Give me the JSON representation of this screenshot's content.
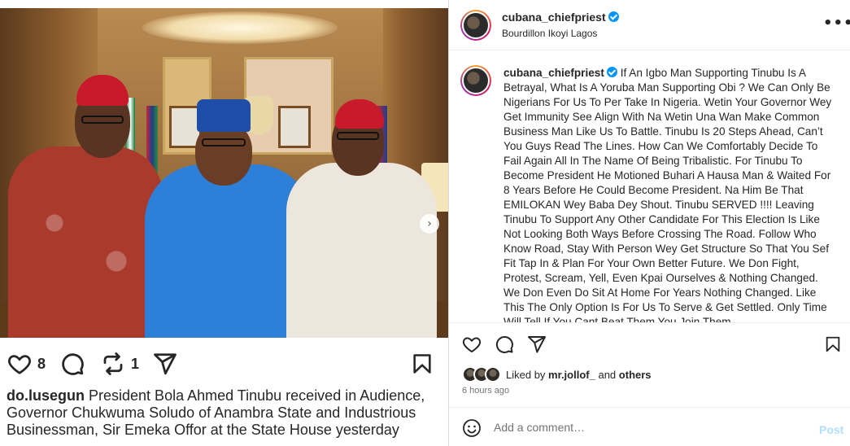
{
  "left_post": {
    "likes_count": "8",
    "reposts_count": "1",
    "caption_user": "do.lusegun",
    "caption_text": "President Bola Ahmed Tinubu received in Audience, Governor Chukwuma Soludo of Anambra State and Industrious Businessman, Sir Emeka Offor at the State House yesterday",
    "icons": [
      "heart-icon",
      "comment-icon",
      "repost-icon",
      "share-icon",
      "bookmark-icon",
      "next-arrow-icon"
    ]
  },
  "header": {
    "username": "cubana_chiefpriest",
    "location": "Bourdillon Ikoyi Lagos",
    "more_glyph": "•••"
  },
  "caption": {
    "username": "cubana_chiefpriest",
    "text": "If An Igbo Man Supporting Tinubu Is A Betrayal, What Is A Yoruba Man Supporting Obi ? We Can Only Be Nigerians For Us To Per Take In Nigeria. Wetin Your Governor Wey Get Immunity See Align With Na Wetin Una Wan Make Common Business Man Like Us To Battle. Tinubu Is 20 Steps Ahead, Can’t You Guys Read The Lines. How Can We Comfortably Decide To Fail Again All In The Name Of Being Tribalistic. For Tinubu To Become President He Motioned Buhari A Hausa Man & Waited For 8 Years Before He Could Become President. Na Him Be That EMILOKAN Wey Baba Dey Shout. Tinubu SERVED !!!! Leaving Tinubu To Support Any Other Candidate For This Election Is Like Not Looking Both Ways Before Crossing The Road. Follow Who Know Road, Stay With Person Wey Get Structure So That You Sef Fit Tap In & Plan For Your Own Better Future. We Don Fight, Protest, Scream, Yell, Even Kpai Ourselves & Nothing Changed. We Don Even Do Sit At Home For Years Nothing Changed. Like This The Only Option Is For Us To Serve & Get Settled. Only Time Will Tell If You Cant Beat Them You Join Them."
  },
  "likes": {
    "prefix": "Liked by",
    "user": "mr.jollof_",
    "and": "and",
    "others": "others"
  },
  "timestamp": "6 hours ago",
  "comment": {
    "placeholder": "Add a comment…",
    "post_label": "Post"
  },
  "colors": {
    "accent": "#0095f6",
    "post_disabled": "#b2dffc",
    "text": "#262626",
    "muted": "#737373"
  }
}
